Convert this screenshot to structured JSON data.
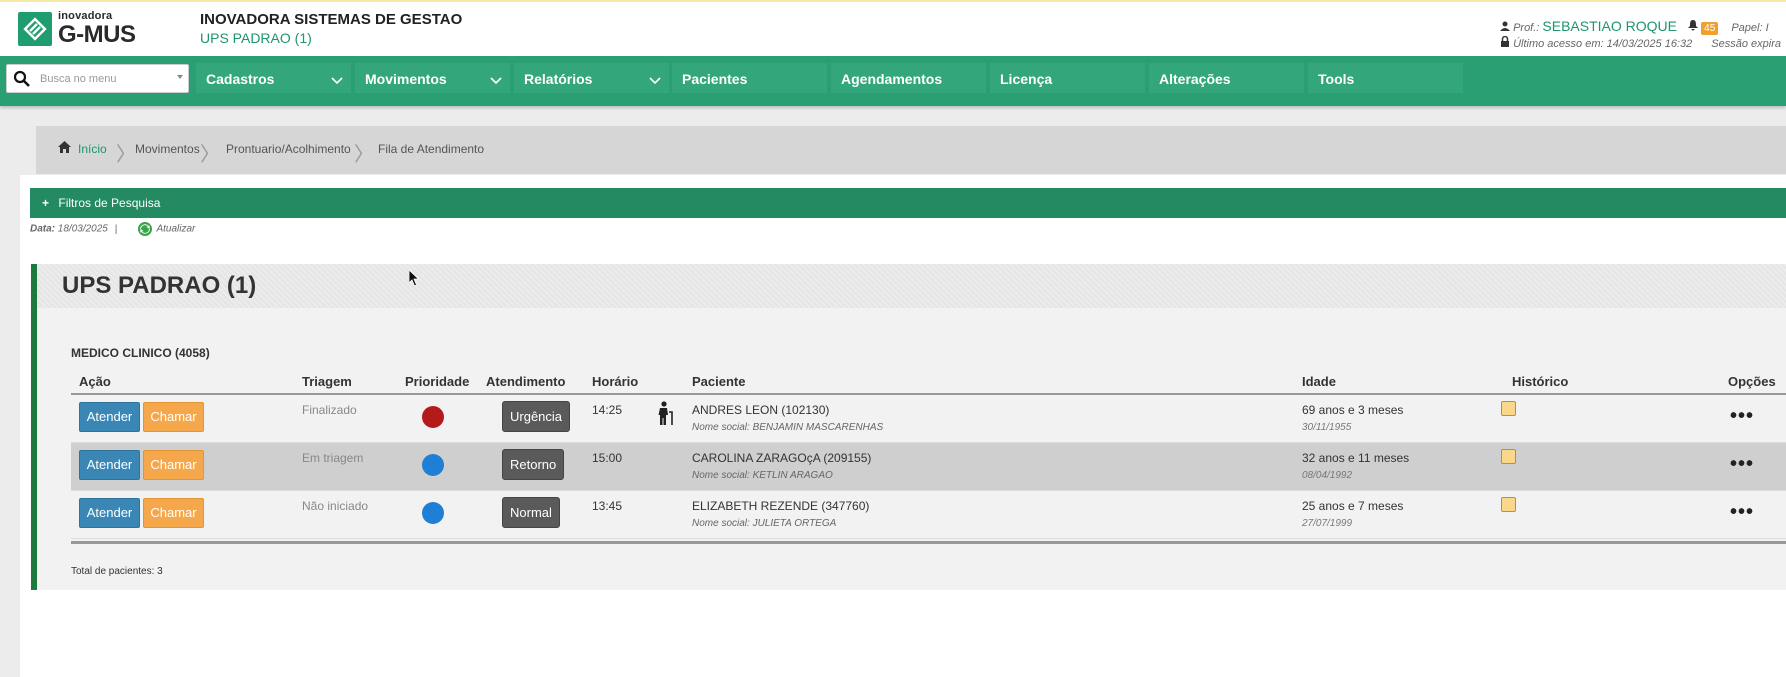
{
  "header": {
    "logo_small": "inovadora",
    "logo_big": "G-MUS",
    "company": "INOVADORA SISTEMAS DE GESTAO",
    "unit": "UPS PADRAO (1)",
    "prof_label": "Prof.:",
    "prof_name": "SEBASTIAO ROQUE",
    "notifications": "45",
    "papel_label": "Papel: I",
    "last_access": "Último acesso em: 14/03/2025 16:32",
    "session": "Sessão expira"
  },
  "menu": {
    "search_placeholder": "Busca no menu",
    "items": [
      "Cadastros",
      "Movimentos",
      "Relatórios",
      "Pacientes",
      "Agendamentos",
      "Licença",
      "Alterações",
      "Tools"
    ]
  },
  "breadcrumb": [
    "Início",
    "Movimentos",
    "Prontuario/Acolhimento",
    "Fila de Atendimento"
  ],
  "filters": {
    "title": "Filtros de Pesquisa",
    "date_label": "Data:",
    "date_value": "18/03/2025",
    "separator": "|",
    "refresh": "Atualizar"
  },
  "unit_card": {
    "title": "UPS PADRAO (1)",
    "section": "MEDICO CLINICO (4058)"
  },
  "table": {
    "headers": [
      "Ação",
      "Triagem",
      "Prioridade",
      "Atendimento",
      "Horário",
      "Paciente",
      "Idade",
      "Histórico",
      "Opções"
    ],
    "atender_label": "Atender",
    "chamar_label": "Chamar",
    "rows": [
      {
        "triagem": "Finalizado",
        "prioridade_color": "#b51a1a",
        "atendimento": "Urgência",
        "horario": "14:25",
        "paciente": "ANDRES LEON (102130)",
        "nome_social": "Nome social: BENJAMIN MASCARENHAS",
        "idade": "69 anos e 3 meses",
        "nascimento": "30/11/1955"
      },
      {
        "triagem": "Em triagem",
        "prioridade_color": "#1f7fd6",
        "atendimento": "Retorno",
        "horario": "15:00",
        "paciente": "CAROLINA ZARAGOçA (209155)",
        "nome_social": "Nome social: KETLIN ARAGAO",
        "idade": "32 anos e 11 meses",
        "nascimento": "08/04/1992"
      },
      {
        "triagem": "Não iniciado",
        "prioridade_color": "#1f7fd6",
        "atendimento": "Normal",
        "horario": "13:45",
        "paciente": "ELIZABETH REZENDE (347760)",
        "nome_social": "Nome social: JULIETA ORTEGA",
        "idade": "25 anos e 7 meses",
        "nascimento": "27/07/1999"
      }
    ],
    "total": "Total de pacientes: 3",
    "options_glyph": "•••"
  }
}
